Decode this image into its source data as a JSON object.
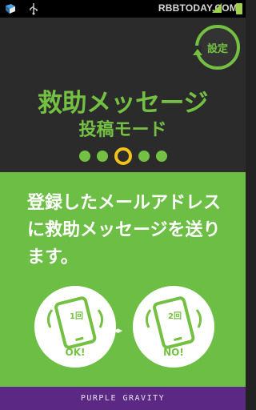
{
  "status_bar": {
    "watermark": "RBBTODAY.COM",
    "icons": [
      "app-cube-icon",
      "usb-icon",
      "signal-icon",
      "battery-icon"
    ]
  },
  "settings": {
    "label": "設定"
  },
  "title": {
    "line1": "救助メッセージ",
    "line2": "投稿モード"
  },
  "pager": {
    "count": 5,
    "active_index": 2
  },
  "description": "登録したメールアドレスに救助メッセージを送ります。",
  "options": [
    {
      "count_label": "1回",
      "caption": "OK!"
    },
    {
      "count_label": "2回",
      "caption": "NO!"
    }
  ],
  "swap_label": "◂▸",
  "footer": {
    "brand": "PURPLE GRAVITY"
  },
  "colors": {
    "accent_green": "#74c043",
    "panel_green": "#6cbf44",
    "dark": "#2b2b2b",
    "active_dot": "#f2c31a",
    "footer_purple": "#5b2883"
  }
}
